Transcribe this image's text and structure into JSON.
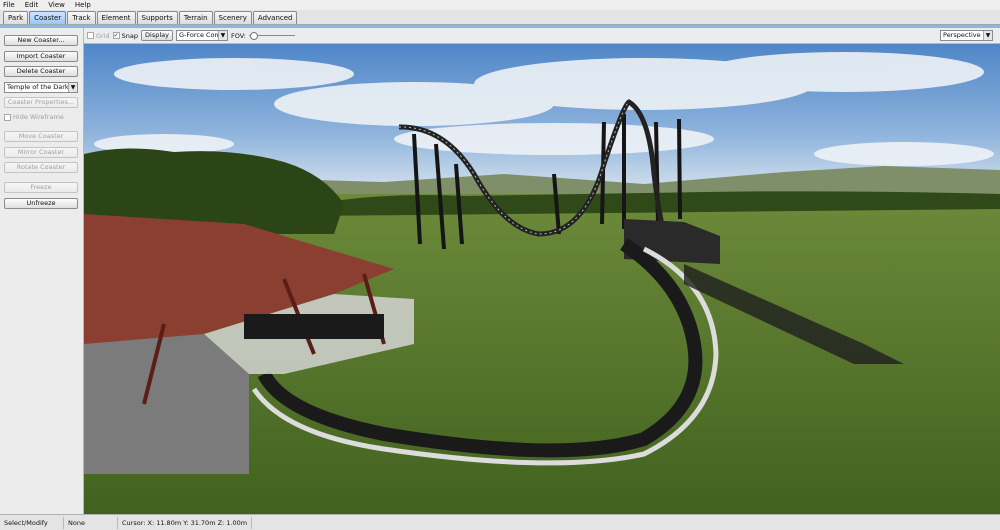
{
  "menu": [
    "File",
    "Edit",
    "View",
    "Help"
  ],
  "tabs": [
    {
      "label": "Park",
      "active": false
    },
    {
      "label": "Coaster",
      "active": true
    },
    {
      "label": "Track",
      "active": false
    },
    {
      "label": "Element",
      "active": false
    },
    {
      "label": "Supports",
      "active": false
    },
    {
      "label": "Terrain",
      "active": false
    },
    {
      "label": "Scenery",
      "active": false
    },
    {
      "label": "Advanced",
      "active": false
    }
  ],
  "sidebar": {
    "new_coaster": "New Coaster...",
    "import_coaster": "Import Coaster",
    "delete_coaster": "Delete Coaster",
    "coaster_select": "Temple of the Dark Ti",
    "coaster_properties": "Coaster Properties...",
    "hide_wireframe": "Hide Wireframe",
    "move_coaster": "Move Coaster",
    "mirror_coaster": "Mirror Coaster",
    "rotate_coaster": "Rotate Coaster",
    "freeze": "Freeze",
    "unfreeze": "Unfreeze"
  },
  "view_toolbar": {
    "grid": "Grid",
    "snap": "Snap",
    "display": "Display",
    "gforce_select": "G-Force Comb",
    "fov": "FOV:",
    "fov_fraction": 0.02,
    "projection": "Perspective"
  },
  "status": {
    "mode": "Select/Modify",
    "selection": "None Selected",
    "cursor": "Cursor: X: 11.80m Y: 31.70m Z: 1.00m"
  },
  "colors": {
    "active_tab": "#9cc6f5",
    "accent": "#8db6e6"
  }
}
